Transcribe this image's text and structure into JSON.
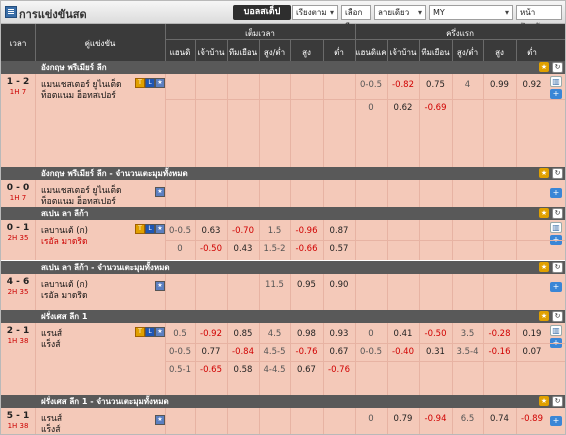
{
  "header": {
    "title": "การแข่งขันสด",
    "live_button": "บอลสเต็ป",
    "sort_select": "เรียงตามเวลา",
    "league_select": "เลือกลีค",
    "odds_select": "ลายเดียว",
    "currency_select": "MY",
    "page_select": "หน้าปัจจุบัน"
  },
  "columns": {
    "time": "เวลา",
    "match": "คู่แข่งขัน",
    "fulltime": "เต็มเวลา",
    "firsthalf": "ครึ่งแรก",
    "ft": [
      "แฮนดิแค",
      "เจ้าบ้าน",
      "ทีมเยือน",
      "สูง/ต่ำ",
      "สูง",
      "ต่ำ"
    ],
    "fh": [
      "แฮนดิแค",
      "เจ้าบ้าน",
      "ทีมเยือน",
      "สูง/ต่ำ",
      "สูง",
      "ต่ำ"
    ]
  },
  "leagues": [
    {
      "name": "อังกฤษ พรีเมียร์ ลีก"
    },
    {
      "name": "อังกฤษ พรีเมียร์ ลีก - จำนวนเตะมุมทั้งหมด"
    },
    {
      "name": "สเปน ลา ลีก้า"
    },
    {
      "name": "สเปน ลา ลีก้า - จำนวนเตะมุมทั้งหมด"
    },
    {
      "name": "ฝรั่งเศส ลีก 1"
    },
    {
      "name": "ฝรั่งเศส ลีก 1 - จำนวนเตะมุมทั้งหมด"
    }
  ],
  "matches": [
    {
      "score": "1 - 2",
      "time": "1H 7",
      "home": "แมนเชสเตอร์ ยูไนเต็ด",
      "away": "ท็อตแนม ฮ็อทสเปอร์",
      "rows": [
        {
          "ft": [
            "",
            "",
            "",
            "",
            "",
            ""
          ],
          "fh": [
            "0-0.5",
            "-0.82",
            "0.75",
            "4",
            "0.99",
            "0.92"
          ]
        },
        {
          "ft": [
            "",
            "",
            "",
            "",
            "",
            ""
          ],
          "fh": [
            "0",
            "0.62",
            "-0.69",
            "",
            "",
            ""
          ]
        }
      ]
    },
    {
      "score": "0 - 0",
      "time": "1H 7",
      "home": "แมนเชสเตอร์ ยูไนเต็ด",
      "away": "ท็อตแนม ฮ็อทสเปอร์",
      "rows": []
    },
    {
      "score": "0 - 1",
      "time": "2H 35",
      "home": "เลบานเต้ (ก)",
      "away": "เรอัล มาดริด",
      "rows": [
        {
          "ft": [
            "0-0.5",
            "0.63",
            "-0.70",
            "1.5",
            "-0.96",
            "0.87"
          ],
          "fh": [
            "",
            "",
            "",
            "",
            "",
            ""
          ]
        },
        {
          "ft": [
            "0",
            "-0.50",
            "0.43",
            "1.5-2",
            "-0.66",
            "0.57"
          ],
          "fh": [
            "",
            "",
            "",
            "",
            "",
            ""
          ]
        }
      ]
    },
    {
      "score": "4 - 6",
      "time": "2H 35",
      "home": "เลบานเต้ (ก)",
      "away": "เรอัล มาดริด",
      "rows": [
        {
          "ft": [
            "",
            "",
            "",
            "11.5",
            "0.95",
            "0.90"
          ],
          "fh": [
            "",
            "",
            "",
            "",
            "",
            ""
          ]
        }
      ]
    },
    {
      "score": "2 - 1",
      "time": "1H 38",
      "home": "แรนส์",
      "away": "แร็งส์",
      "rows": [
        {
          "ft": [
            "0.5",
            "-0.92",
            "0.85",
            "4.5",
            "0.98",
            "0.93"
          ],
          "fh": [
            "0",
            "0.41",
            "-0.50",
            "3.5",
            "-0.28",
            "0.19"
          ]
        },
        {
          "ft": [
            "0-0.5",
            "0.77",
            "-0.84",
            "4.5-5",
            "-0.76",
            "0.67"
          ],
          "fh": [
            "0-0.5",
            "-0.40",
            "0.31",
            "3.5-4",
            "-0.16",
            "0.07"
          ]
        },
        {
          "ft": [
            "0.5-1",
            "-0.65",
            "0.58",
            "4-4.5",
            "0.67",
            "-0.76"
          ],
          "fh": [
            "",
            "",
            "",
            "",
            "",
            ""
          ]
        }
      ]
    },
    {
      "score": "5 - 1",
      "time": "1H 38",
      "home": "แรนส์",
      "away": "แร็งส์",
      "rows": [
        {
          "ft": [
            "",
            "",
            "",
            "",
            "",
            ""
          ],
          "fh": [
            "0",
            "0.79",
            "-0.94",
            "6.5",
            "0.74",
            "-0.89"
          ]
        }
      ]
    }
  ],
  "badges": {
    "tv": "TV",
    "live": "L",
    "stats": "S"
  },
  "colors": {
    "header_bg": "#3a3a3a",
    "league_bg": "#595959",
    "row_bg": "#f4c9b9",
    "negative": "#d00000"
  }
}
